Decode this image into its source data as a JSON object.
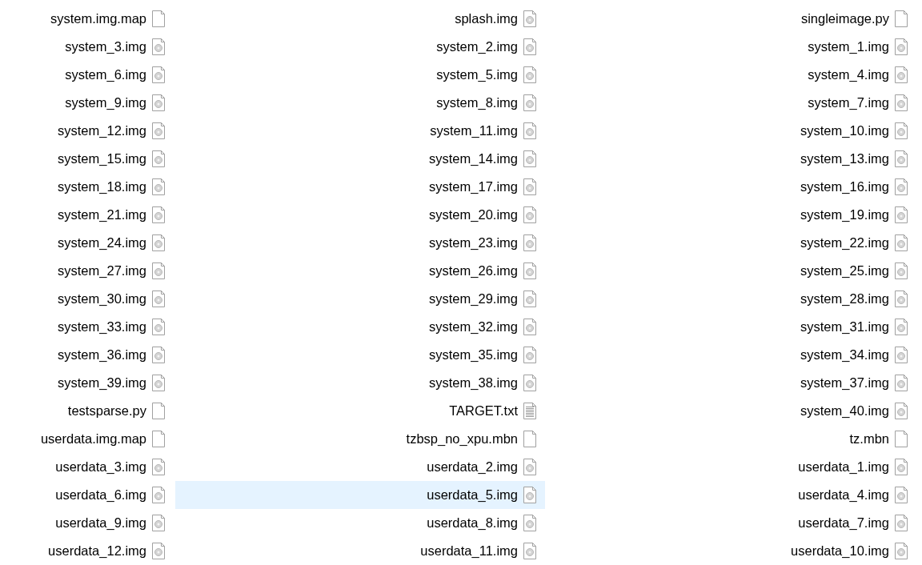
{
  "files": [
    {
      "name": "system.img.map",
      "kind": "blank",
      "selected": false
    },
    {
      "name": "splash.img",
      "kind": "image",
      "selected": false
    },
    {
      "name": "singleimage.py",
      "kind": "blank",
      "selected": false
    },
    {
      "name": "system_3.img",
      "kind": "image",
      "selected": false
    },
    {
      "name": "system_2.img",
      "kind": "image",
      "selected": false
    },
    {
      "name": "system_1.img",
      "kind": "image",
      "selected": false
    },
    {
      "name": "system_6.img",
      "kind": "image",
      "selected": false
    },
    {
      "name": "system_5.img",
      "kind": "image",
      "selected": false
    },
    {
      "name": "system_4.img",
      "kind": "image",
      "selected": false
    },
    {
      "name": "system_9.img",
      "kind": "image",
      "selected": false
    },
    {
      "name": "system_8.img",
      "kind": "image",
      "selected": false
    },
    {
      "name": "system_7.img",
      "kind": "image",
      "selected": false
    },
    {
      "name": "system_12.img",
      "kind": "image",
      "selected": false
    },
    {
      "name": "system_11.img",
      "kind": "image",
      "selected": false
    },
    {
      "name": "system_10.img",
      "kind": "image",
      "selected": false
    },
    {
      "name": "system_15.img",
      "kind": "image",
      "selected": false
    },
    {
      "name": "system_14.img",
      "kind": "image",
      "selected": false
    },
    {
      "name": "system_13.img",
      "kind": "image",
      "selected": false
    },
    {
      "name": "system_18.img",
      "kind": "image",
      "selected": false
    },
    {
      "name": "system_17.img",
      "kind": "image",
      "selected": false
    },
    {
      "name": "system_16.img",
      "kind": "image",
      "selected": false
    },
    {
      "name": "system_21.img",
      "kind": "image",
      "selected": false
    },
    {
      "name": "system_20.img",
      "kind": "image",
      "selected": false
    },
    {
      "name": "system_19.img",
      "kind": "image",
      "selected": false
    },
    {
      "name": "system_24.img",
      "kind": "image",
      "selected": false
    },
    {
      "name": "system_23.img",
      "kind": "image",
      "selected": false
    },
    {
      "name": "system_22.img",
      "kind": "image",
      "selected": false
    },
    {
      "name": "system_27.img",
      "kind": "image",
      "selected": false
    },
    {
      "name": "system_26.img",
      "kind": "image",
      "selected": false
    },
    {
      "name": "system_25.img",
      "kind": "image",
      "selected": false
    },
    {
      "name": "system_30.img",
      "kind": "image",
      "selected": false
    },
    {
      "name": "system_29.img",
      "kind": "image",
      "selected": false
    },
    {
      "name": "system_28.img",
      "kind": "image",
      "selected": false
    },
    {
      "name": "system_33.img",
      "kind": "image",
      "selected": false
    },
    {
      "name": "system_32.img",
      "kind": "image",
      "selected": false
    },
    {
      "name": "system_31.img",
      "kind": "image",
      "selected": false
    },
    {
      "name": "system_36.img",
      "kind": "image",
      "selected": false
    },
    {
      "name": "system_35.img",
      "kind": "image",
      "selected": false
    },
    {
      "name": "system_34.img",
      "kind": "image",
      "selected": false
    },
    {
      "name": "system_39.img",
      "kind": "image",
      "selected": false
    },
    {
      "name": "system_38.img",
      "kind": "image",
      "selected": false
    },
    {
      "name": "system_37.img",
      "kind": "image",
      "selected": false
    },
    {
      "name": "testsparse.py",
      "kind": "blank",
      "selected": false
    },
    {
      "name": "TARGET.txt",
      "kind": "text",
      "selected": false
    },
    {
      "name": "system_40.img",
      "kind": "image",
      "selected": false
    },
    {
      "name": "userdata.img.map",
      "kind": "blank",
      "selected": false
    },
    {
      "name": "tzbsp_no_xpu.mbn",
      "kind": "blank",
      "selected": false
    },
    {
      "name": "tz.mbn",
      "kind": "blank",
      "selected": false
    },
    {
      "name": "userdata_3.img",
      "kind": "image",
      "selected": false
    },
    {
      "name": "userdata_2.img",
      "kind": "image",
      "selected": false
    },
    {
      "name": "userdata_1.img",
      "kind": "image",
      "selected": false
    },
    {
      "name": "userdata_6.img",
      "kind": "image",
      "selected": false
    },
    {
      "name": "userdata_5.img",
      "kind": "image",
      "selected": true
    },
    {
      "name": "userdata_4.img",
      "kind": "image",
      "selected": false
    },
    {
      "name": "userdata_9.img",
      "kind": "image",
      "selected": false
    },
    {
      "name": "userdata_8.img",
      "kind": "image",
      "selected": false
    },
    {
      "name": "userdata_7.img",
      "kind": "image",
      "selected": false
    },
    {
      "name": "userdata_12.img",
      "kind": "image",
      "selected": false
    },
    {
      "name": "userdata_11.img",
      "kind": "image",
      "selected": false
    },
    {
      "name": "userdata_10.img",
      "kind": "image",
      "selected": false
    }
  ]
}
